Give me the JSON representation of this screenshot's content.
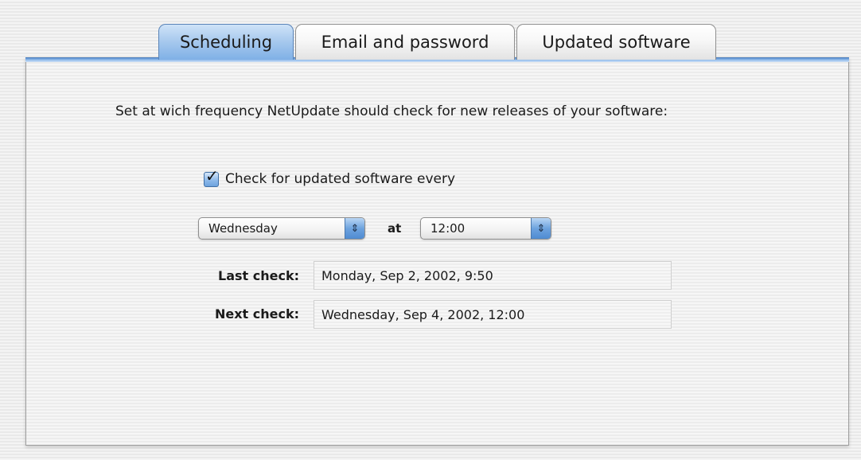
{
  "tabs": [
    {
      "label": "Scheduling",
      "active": true
    },
    {
      "label": "Email and password",
      "active": false
    },
    {
      "label": "Updated software",
      "active": false
    }
  ],
  "scheduling": {
    "description": "Set at wich frequency NetUpdate should check for new releases of your software:",
    "checkbox": {
      "label": "Check for updated software every",
      "checked": true
    },
    "day_popup": {
      "value": "Wednesday"
    },
    "at_label": "at",
    "time_popup": {
      "value": "12:00"
    },
    "last_check": {
      "label": "Last check:",
      "value": "Monday, Sep 2, 2002, 9:50"
    },
    "next_check": {
      "label": "Next check:",
      "value": "Wednesday, Sep 4, 2002, 12:00"
    }
  },
  "colors": {
    "accent_blue": "#6ea3de",
    "tab_active_blue": "#a9caee",
    "panel_stripe": "#ececec"
  },
  "icons": {
    "checkmark": "checkmark-icon",
    "popup_arrows": "popup-arrows-icon"
  }
}
